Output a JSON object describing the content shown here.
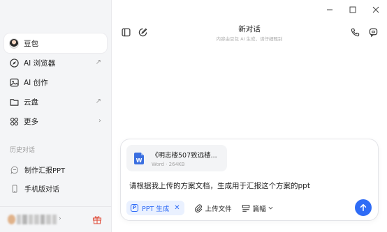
{
  "window": {
    "minimize": "—",
    "maximize": "☐",
    "close": "✕"
  },
  "sidebar": {
    "items": [
      {
        "label": "豆包",
        "icon": "avatar",
        "active": true
      },
      {
        "label": "AI 浏览器",
        "icon": "compass-icon",
        "trail": "↗"
      },
      {
        "label": "AI 创作",
        "icon": "image-icon"
      },
      {
        "label": "云盘",
        "icon": "folder-icon",
        "trail": "↗"
      },
      {
        "label": "更多",
        "icon": "grid-icon",
        "trail": "›"
      }
    ],
    "history_title": "历史对话",
    "history": [
      {
        "label": "制作汇报PPT",
        "icon": "chat-icon"
      },
      {
        "label": "手机版对话",
        "icon": "phone-icon"
      }
    ]
  },
  "main": {
    "title": "新对话",
    "subtitle": "内容由豆包 AI 生成，请仔细甄别"
  },
  "composer": {
    "attachment": {
      "name": "《明志楼507致远楼...",
      "meta": "Word · 264KB",
      "type_letter": "W"
    },
    "prompt": "请根据我上传的方案文档，生成用于汇报这个方案的ppt",
    "skill_chip": {
      "label": "PPT 生成",
      "icon_letter": "P",
      "remove": "✕"
    },
    "upload_label": "上传文件",
    "length_label": "篇幅"
  },
  "colors": {
    "accent": "#2f6cf6",
    "doc": "#3b6fe0",
    "gift": "#e0513f"
  }
}
